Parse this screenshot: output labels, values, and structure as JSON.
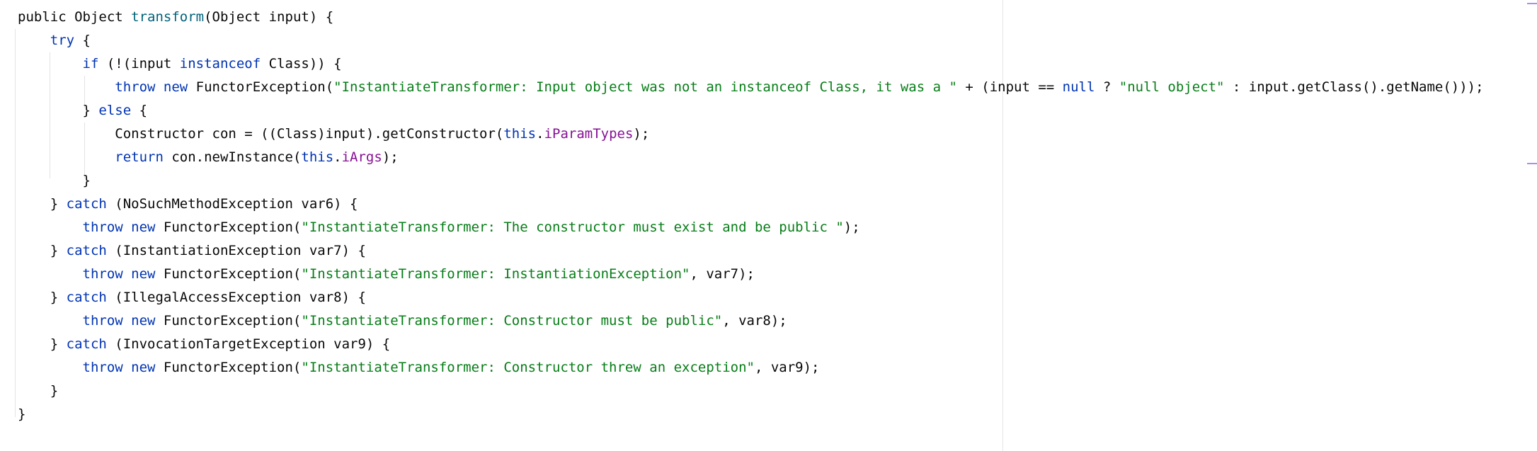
{
  "editor": {
    "colors": {
      "keyword": "#0033b3",
      "string": "#067d17",
      "method": "#00627a",
      "field": "#871094",
      "plain": "#080808",
      "scroll_marker": "#b18ce8"
    },
    "lines": [
      [
        {
          "t": "plain",
          "v": "public "
        },
        {
          "t": "plain",
          "v": "Object "
        },
        {
          "t": "method",
          "v": "transform"
        },
        {
          "t": "plain",
          "v": "(Object input) {"
        }
      ],
      [
        {
          "t": "plain",
          "v": "    "
        },
        {
          "t": "keyword",
          "v": "try"
        },
        {
          "t": "plain",
          "v": " {"
        }
      ],
      [
        {
          "t": "plain",
          "v": "        "
        },
        {
          "t": "keyword",
          "v": "if"
        },
        {
          "t": "plain",
          "v": " (!(input "
        },
        {
          "t": "keyword",
          "v": "instanceof"
        },
        {
          "t": "plain",
          "v": " Class)) {"
        }
      ],
      [
        {
          "t": "plain",
          "v": "            "
        },
        {
          "t": "keyword",
          "v": "throw new"
        },
        {
          "t": "plain",
          "v": " FunctorException("
        },
        {
          "t": "string",
          "v": "\"InstantiateTransformer: Input object was not an instanceof Class, it was a \""
        },
        {
          "t": "plain",
          "v": " + (input == "
        },
        {
          "t": "keyword",
          "v": "null"
        },
        {
          "t": "plain",
          "v": " ? "
        },
        {
          "t": "string",
          "v": "\"null object\""
        },
        {
          "t": "plain",
          "v": " : input.getClass().getName()));"
        }
      ],
      [
        {
          "t": "plain",
          "v": "        } "
        },
        {
          "t": "keyword",
          "v": "else"
        },
        {
          "t": "plain",
          "v": " {"
        }
      ],
      [
        {
          "t": "plain",
          "v": "            Constructor con = ((Class)input).getConstructor("
        },
        {
          "t": "keyword",
          "v": "this"
        },
        {
          "t": "plain",
          "v": "."
        },
        {
          "t": "field",
          "v": "iParamTypes"
        },
        {
          "t": "plain",
          "v": ");"
        }
      ],
      [
        {
          "t": "plain",
          "v": "            "
        },
        {
          "t": "keyword",
          "v": "return"
        },
        {
          "t": "plain",
          "v": " con.newInstance("
        },
        {
          "t": "keyword",
          "v": "this"
        },
        {
          "t": "plain",
          "v": "."
        },
        {
          "t": "field",
          "v": "iArgs"
        },
        {
          "t": "plain",
          "v": ");"
        }
      ],
      [
        {
          "t": "plain",
          "v": "        }"
        }
      ],
      [
        {
          "t": "plain",
          "v": "    } "
        },
        {
          "t": "keyword",
          "v": "catch"
        },
        {
          "t": "plain",
          "v": " (NoSuchMethodException var6) {"
        }
      ],
      [
        {
          "t": "plain",
          "v": "        "
        },
        {
          "t": "keyword",
          "v": "throw new"
        },
        {
          "t": "plain",
          "v": " FunctorException("
        },
        {
          "t": "string",
          "v": "\"InstantiateTransformer: The constructor must exist and be public \""
        },
        {
          "t": "plain",
          "v": ");"
        }
      ],
      [
        {
          "t": "plain",
          "v": "    } "
        },
        {
          "t": "keyword",
          "v": "catch"
        },
        {
          "t": "plain",
          "v": " (InstantiationException var7) {"
        }
      ],
      [
        {
          "t": "plain",
          "v": "        "
        },
        {
          "t": "keyword",
          "v": "throw new"
        },
        {
          "t": "plain",
          "v": " FunctorException("
        },
        {
          "t": "string",
          "v": "\"InstantiateTransformer: InstantiationException\""
        },
        {
          "t": "plain",
          "v": ", var7);"
        }
      ],
      [
        {
          "t": "plain",
          "v": "    } "
        },
        {
          "t": "keyword",
          "v": "catch"
        },
        {
          "t": "plain",
          "v": " (IllegalAccessException var8) {"
        }
      ],
      [
        {
          "t": "plain",
          "v": "        "
        },
        {
          "t": "keyword",
          "v": "throw new"
        },
        {
          "t": "plain",
          "v": " FunctorException("
        },
        {
          "t": "string",
          "v": "\"InstantiateTransformer: Constructor must be public\""
        },
        {
          "t": "plain",
          "v": ", var8);"
        }
      ],
      [
        {
          "t": "plain",
          "v": "    } "
        },
        {
          "t": "keyword",
          "v": "catch"
        },
        {
          "t": "plain",
          "v": " (InvocationTargetException var9) {"
        }
      ],
      [
        {
          "t": "plain",
          "v": "        "
        },
        {
          "t": "keyword",
          "v": "throw new"
        },
        {
          "t": "plain",
          "v": " FunctorException("
        },
        {
          "t": "string",
          "v": "\"InstantiateTransformer: Constructor threw an exception\""
        },
        {
          "t": "plain",
          "v": ", var9);"
        }
      ],
      [
        {
          "t": "plain",
          "v": "    }"
        }
      ],
      [
        {
          "t": "plain",
          "v": "}"
        }
      ]
    ]
  }
}
